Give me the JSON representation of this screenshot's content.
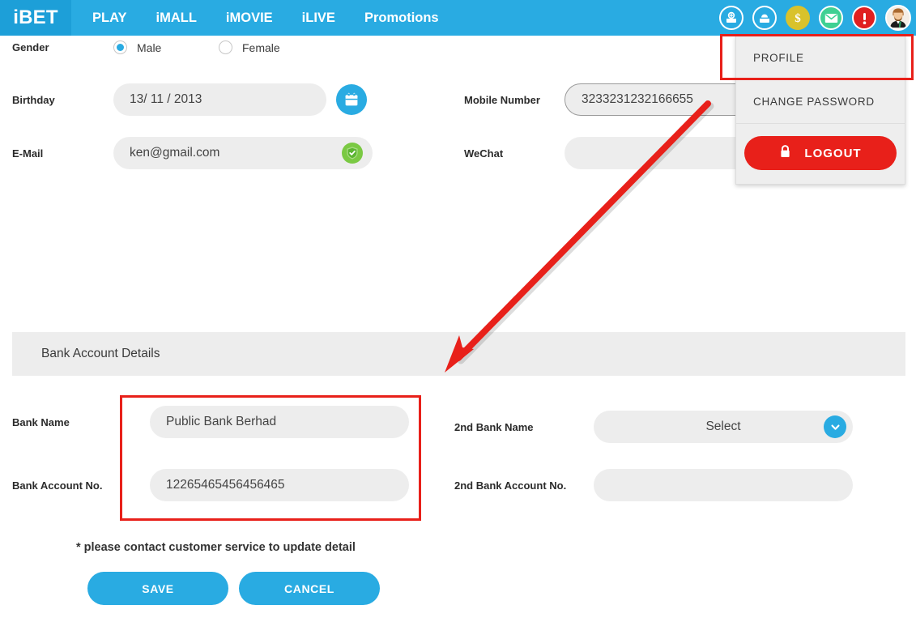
{
  "header": {
    "logo": "iBET",
    "nav": [
      {
        "label": "PLAY"
      },
      {
        "label": "iMALL"
      },
      {
        "label": "iMOVIE"
      },
      {
        "label": "iLIVE"
      },
      {
        "label": "Promotions"
      }
    ],
    "icons": [
      {
        "name": "deposit-icon"
      },
      {
        "name": "withdraw-icon"
      },
      {
        "name": "balance-icon"
      },
      {
        "name": "message-icon"
      },
      {
        "name": "alert-icon"
      },
      {
        "name": "avatar"
      }
    ]
  },
  "dropdown": {
    "profile_label": "PROFILE",
    "change_password_label": "CHANGE PASSWORD",
    "logout_label": "LOGOUT"
  },
  "form": {
    "gender_label": "Gender",
    "gender_options": [
      {
        "label": "Male",
        "selected": true
      },
      {
        "label": "Female",
        "selected": false
      }
    ],
    "birthday_label": "Birthday",
    "birthday_value": "13/ 11 / 2013",
    "email_label": "E-Mail",
    "email_value": "ken@gmail.com",
    "mobile_label": "Mobile Number",
    "mobile_value": "3233231232166655",
    "wechat_label": "WeChat",
    "wechat_value": ""
  },
  "bank": {
    "section_title": "Bank Account Details",
    "bank_name_label": "Bank Name",
    "bank_name_value": "Public Bank Berhad",
    "bank_account_label": "Bank Account No.",
    "bank_account_value": "12265465456456465",
    "second_bank_name_label": "2nd Bank Name",
    "second_bank_name_value": "Select",
    "second_bank_account_label": "2nd Bank Account No.",
    "second_bank_account_value": ""
  },
  "footer": {
    "note": "* please contact customer service to update detail",
    "save_label": "SAVE",
    "cancel_label": "CANCEL"
  },
  "colors": {
    "brand_blue": "#29abe2",
    "logo_blue": "#1d9fd8",
    "accent_red": "#e8201a",
    "field_gray": "#ededed",
    "gold": "#d9c22b",
    "green": "#3fd093",
    "shield_green": "#7ac943"
  }
}
